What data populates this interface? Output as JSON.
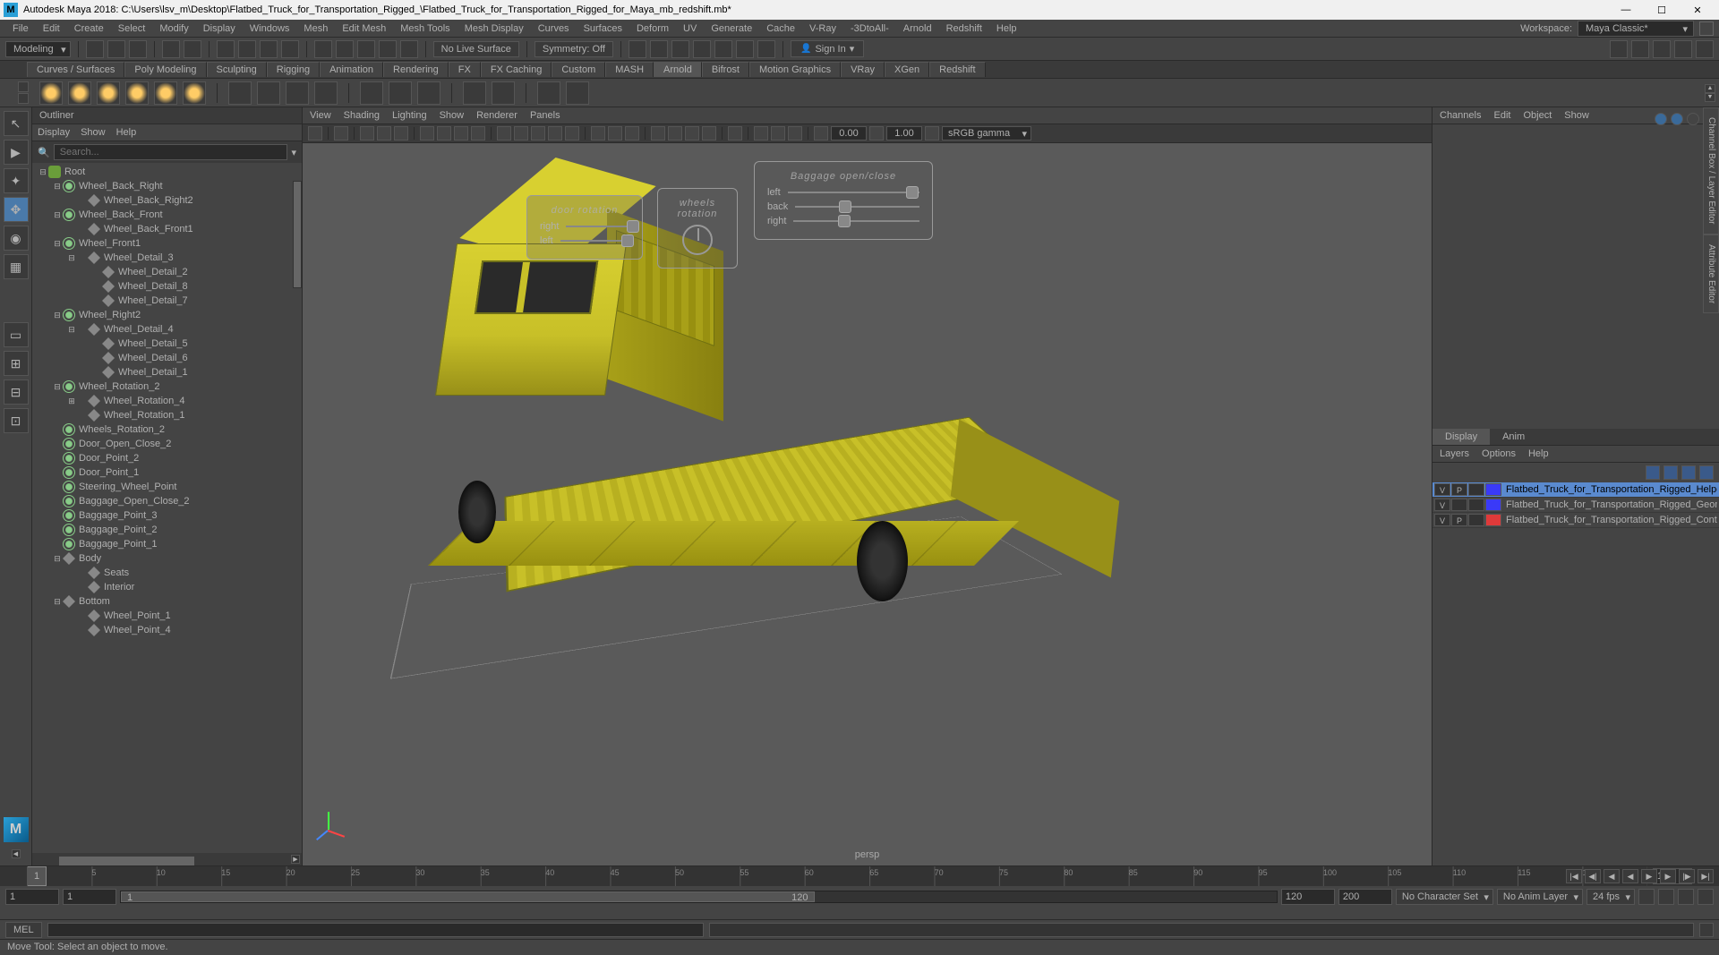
{
  "title": "Autodesk Maya 2018: C:\\Users\\lsv_m\\Desktop\\Flatbed_Truck_for_Transportation_Rigged_\\Flatbed_Truck_for_Transportation_Rigged_for_Maya_mb_redshift.mb*",
  "menus": [
    "File",
    "Edit",
    "Create",
    "Select",
    "Modify",
    "Display",
    "Windows",
    "Mesh",
    "Edit Mesh",
    "Mesh Tools",
    "Mesh Display",
    "Curves",
    "Surfaces",
    "Deform",
    "UV",
    "Generate",
    "Cache",
    "V-Ray",
    "-3DtoAll-",
    "Arnold",
    "Redshift",
    "Help"
  ],
  "workspace_label": "Workspace:",
  "workspace_value": "Maya Classic*",
  "module_dd": "Modeling",
  "no_live_surface": "No Live Surface",
  "symmetry": "Symmetry: Off",
  "signin": "Sign In",
  "shelf_tabs": [
    "Curves / Surfaces",
    "Poly Modeling",
    "Sculpting",
    "Rigging",
    "Animation",
    "Rendering",
    "FX",
    "FX Caching",
    "Custom",
    "MASH",
    "Arnold",
    "Bifrost",
    "Motion Graphics",
    "VRay",
    "XGen",
    "Redshift"
  ],
  "shelf_active": "Arnold",
  "outliner": {
    "title": "Outliner",
    "menus": [
      "Display",
      "Show",
      "Help"
    ],
    "search_placeholder": "Search...",
    "tree": [
      {
        "l": 0,
        "t": "e",
        "ic": "root",
        "n": "Root"
      },
      {
        "l": 1,
        "t": "e",
        "ic": "joint",
        "n": "Wheel_Back_Right"
      },
      {
        "l": 2,
        "t": "",
        "ic": "transform",
        "n": "Wheel_Back_Right2"
      },
      {
        "l": 1,
        "t": "e",
        "ic": "joint",
        "n": "Wheel_Back_Front"
      },
      {
        "l": 2,
        "t": "",
        "ic": "transform",
        "n": "Wheel_Back_Front1"
      },
      {
        "l": 1,
        "t": "e",
        "ic": "joint",
        "n": "Wheel_Front1"
      },
      {
        "l": 2,
        "t": "e",
        "ic": "transform",
        "n": "Wheel_Detail_3"
      },
      {
        "l": 3,
        "t": "",
        "ic": "transform",
        "n": "Wheel_Detail_2"
      },
      {
        "l": 3,
        "t": "",
        "ic": "transform",
        "n": "Wheel_Detail_8"
      },
      {
        "l": 3,
        "t": "",
        "ic": "transform",
        "n": "Wheel_Detail_7"
      },
      {
        "l": 1,
        "t": "e",
        "ic": "joint",
        "n": "Wheel_Right2"
      },
      {
        "l": 2,
        "t": "e",
        "ic": "transform",
        "n": "Wheel_Detail_4"
      },
      {
        "l": 3,
        "t": "",
        "ic": "transform",
        "n": "Wheel_Detail_5"
      },
      {
        "l": 3,
        "t": "",
        "ic": "transform",
        "n": "Wheel_Detail_6"
      },
      {
        "l": 3,
        "t": "",
        "ic": "transform",
        "n": "Wheel_Detail_1"
      },
      {
        "l": 1,
        "t": "e",
        "ic": "joint",
        "n": "Wheel_Rotation_2"
      },
      {
        "l": 2,
        "t": "c",
        "ic": "transform",
        "n": "Wheel_Rotation_4"
      },
      {
        "l": 2,
        "t": "",
        "ic": "transform",
        "n": "Wheel_Rotation_1"
      },
      {
        "l": 1,
        "t": "",
        "ic": "joint",
        "n": "Wheels_Rotation_2"
      },
      {
        "l": 1,
        "t": "",
        "ic": "joint",
        "n": "Door_Open_Close_2"
      },
      {
        "l": 1,
        "t": "",
        "ic": "joint",
        "n": "Door_Point_2"
      },
      {
        "l": 1,
        "t": "",
        "ic": "joint",
        "n": "Door_Point_1"
      },
      {
        "l": 1,
        "t": "",
        "ic": "joint",
        "n": "Steering_Wheel_Point"
      },
      {
        "l": 1,
        "t": "",
        "ic": "joint",
        "n": "Baggage_Open_Close_2"
      },
      {
        "l": 1,
        "t": "",
        "ic": "joint",
        "n": "Baggage_Point_3"
      },
      {
        "l": 1,
        "t": "",
        "ic": "joint",
        "n": "Baggage_Point_2"
      },
      {
        "l": 1,
        "t": "",
        "ic": "joint",
        "n": "Baggage_Point_1"
      },
      {
        "l": 1,
        "t": "e",
        "ic": "transform",
        "n": "Body"
      },
      {
        "l": 2,
        "t": "",
        "ic": "transform",
        "n": "Seats"
      },
      {
        "l": 2,
        "t": "",
        "ic": "transform",
        "n": "Interior"
      },
      {
        "l": 1,
        "t": "e",
        "ic": "transform",
        "n": "Bottom"
      },
      {
        "l": 2,
        "t": "",
        "ic": "transform",
        "n": "Wheel_Point_1"
      },
      {
        "l": 2,
        "t": "",
        "ic": "transform",
        "n": "Wheel_Point_4"
      }
    ]
  },
  "viewport": {
    "menus": [
      "View",
      "Shading",
      "Lighting",
      "Show",
      "Renderer",
      "Panels"
    ],
    "exp1": "0.00",
    "exp2": "1.00",
    "colorspace": "sRGB gamma",
    "camera": "persp",
    "hud1": {
      "title": "door rotation",
      "rows": [
        "right",
        "left"
      ]
    },
    "hud2": {
      "title": "wheels rotation"
    },
    "hud3": {
      "title": "Baggage open/close",
      "rows": [
        "left",
        "back",
        "right"
      ]
    }
  },
  "right": {
    "menus": [
      "Channels",
      "Edit",
      "Object",
      "Show"
    ],
    "vtabs": [
      "Channel Box / Layer Editor",
      "Attribute Editor"
    ],
    "display_tabs": [
      "Display",
      "Anim"
    ],
    "display_active": "Display",
    "layer_menus": [
      "Layers",
      "Options",
      "Help"
    ],
    "layers": [
      {
        "v": "V",
        "p": "P",
        "x": "",
        "color": "#3a3af8",
        "name": "Flatbed_Truck_for_Transportation_Rigged_Helpers",
        "sel": true
      },
      {
        "v": "V",
        "p": "",
        "x": "",
        "color": "#3a3af8",
        "name": "Flatbed_Truck_for_Transportation_Rigged_Geometry",
        "sel": false
      },
      {
        "v": "V",
        "p": "P",
        "x": "",
        "color": "#e03a3a",
        "name": "Flatbed_Truck_for_Transportation_Rigged_Controllers",
        "sel": false
      }
    ]
  },
  "timeline": {
    "marker": "1",
    "ticks": [
      "5",
      "10",
      "15",
      "20",
      "25",
      "30",
      "35",
      "40",
      "45",
      "50",
      "55",
      "60",
      "65",
      "70",
      "75",
      "80",
      "85",
      "90",
      "95",
      "100",
      "105",
      "110",
      "115",
      "120"
    ],
    "cur_frame_right": "1",
    "range_start_outer": "1",
    "range_start_inner": "1",
    "range_badge": "1",
    "range_mid": "120",
    "range_end_inner": "120",
    "range_end_outer": "200",
    "char_set": "No Character Set",
    "anim_layer": "No Anim Layer",
    "fps": "24 fps"
  },
  "mel_label": "MEL",
  "status": "Move Tool: Select an object to move."
}
